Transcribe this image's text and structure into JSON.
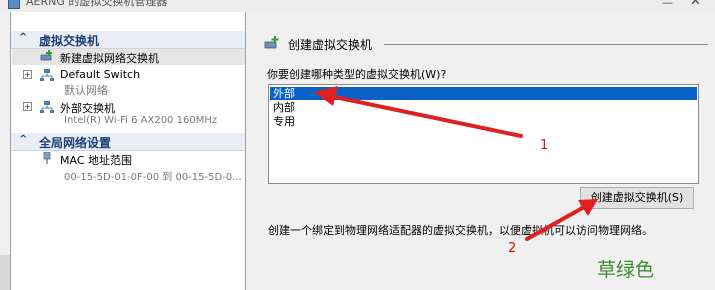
{
  "window": {
    "title": "AERNG 的虚拟交换机管理器",
    "minimize_glyph": "—",
    "close_glyph": "✕"
  },
  "sidebar": {
    "section_switches": {
      "chevron": "^",
      "title": "虚拟交换机"
    },
    "items": [
      {
        "label": "新建虚拟网络交换机",
        "selected": true,
        "icon": "new-switch-icon"
      },
      {
        "label": "Default Switch",
        "sub": "默认网络",
        "expander": "+",
        "icon": "network-switch-icon"
      },
      {
        "label": "外部交换机",
        "sub": "Intel(R) Wi-Fi 6 AX200 160MHz",
        "expander": "+",
        "icon": "network-switch-icon"
      }
    ],
    "section_global": {
      "chevron": "^",
      "title": "全局网络设置"
    },
    "global_items": [
      {
        "label": "MAC 地址范围",
        "sub": "00-15-5D-01-0F-00 到 00-15-5D-0...",
        "icon": "mac-address-icon"
      }
    ]
  },
  "main": {
    "group_title": "创建虚拟交换机",
    "prompt": "你要创建哪种类型的虚拟交换机(W)?",
    "options": [
      "外部",
      "内部",
      "专用"
    ],
    "selected_option": "外部",
    "create_button": "创建虚拟交换机(S)",
    "description": "创建一个绑定到物理网络适配器的虚拟交换机，以便虚拟机可以访问物理网络。"
  },
  "annotations": {
    "marker_1": "1",
    "marker_2": "2",
    "caption": "草绿色",
    "arrow_color": "#e02020",
    "caption_color": "#3a8a2f"
  },
  "colors": {
    "selection": "#0a62c8",
    "section_text": "#1c3f7a"
  }
}
